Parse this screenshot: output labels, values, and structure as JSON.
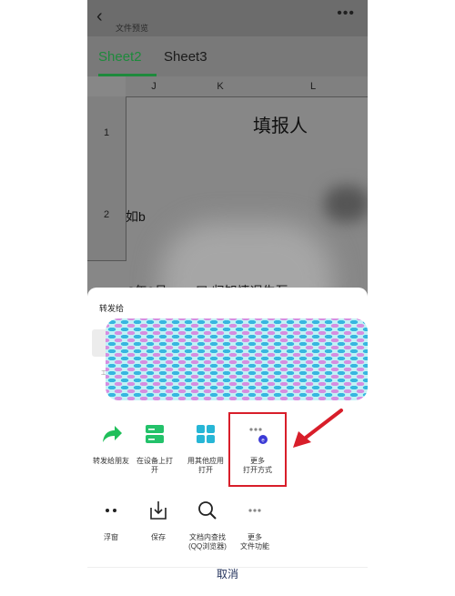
{
  "header": {
    "back_icon": "chevron-left-icon",
    "subtitle": "文件预览",
    "more_icon": "ellipsis-icon"
  },
  "tabs": [
    {
      "label": "Sheet2",
      "active": true
    },
    {
      "label": "Sheet3",
      "active": false
    }
  ],
  "grid": {
    "columns": [
      "J",
      "K",
      "L"
    ],
    "rows": [
      "1",
      "2"
    ],
    "cells": {
      "L1": "填报人",
      "J2": "如b"
    },
    "partial_text": "2年9月... ... 口 归知情况生互"
  },
  "share_sheet": {
    "forward_title": "转发给",
    "contacts_tiny": "工",
    "actions_row1": [
      {
        "label": "转发给朋友",
        "icon": "forward-arrow-icon",
        "color": "#1fbf5a"
      },
      {
        "label": "在设备上打\n开",
        "icon": "device-open-icon",
        "color": "#23c26a"
      },
      {
        "label": "用其他应用\n打开",
        "icon": "apps-grid-icon",
        "color": "#27b6d6"
      },
      {
        "label": "更多\n打开方式",
        "icon": "more-open-ways-icon",
        "color": "#3b3ad6"
      }
    ],
    "actions_row2": [
      {
        "label": "浮窗",
        "icon": "float-window-icon"
      },
      {
        "label": "保存",
        "icon": "save-download-icon"
      },
      {
        "label": "文档内查找\n(QQ浏览器)",
        "icon": "search-icon"
      },
      {
        "label": "更多\n文件功能",
        "icon": "more-file-functions-icon"
      }
    ],
    "cancel_label": "取消"
  },
  "colors": {
    "accent_green": "#1e8a3c",
    "highlight_red": "#d81e2a",
    "cancel_text": "#25345e"
  }
}
